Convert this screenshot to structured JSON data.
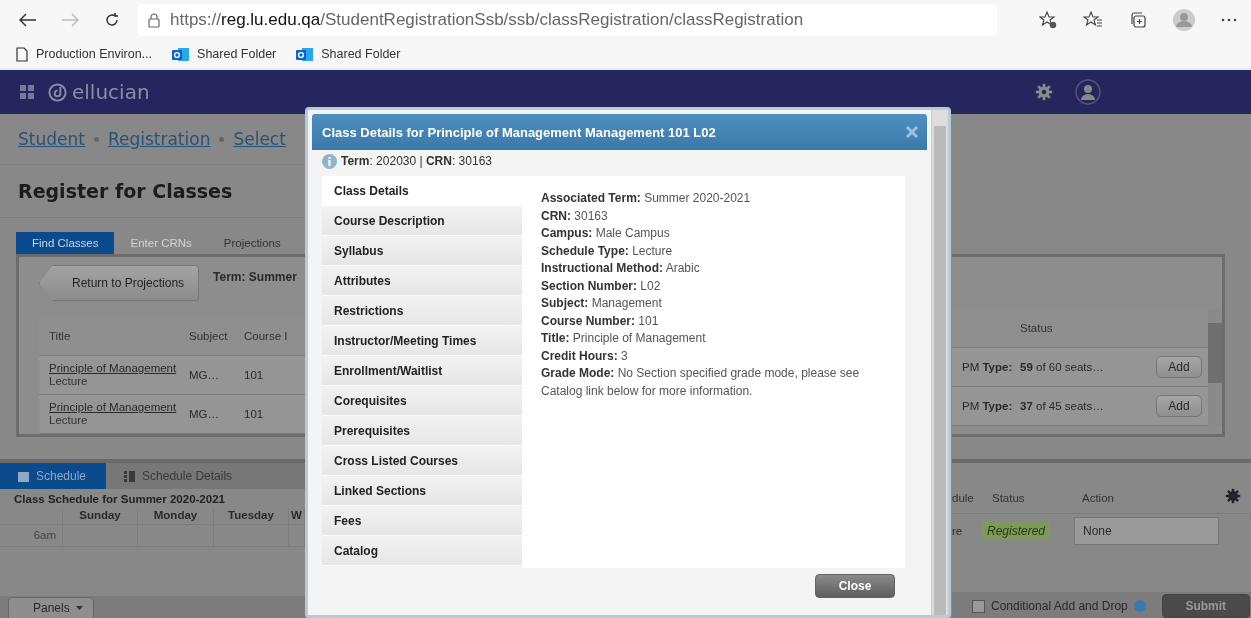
{
  "browser": {
    "nav_buttons": [
      {
        "kind": "back",
        "disabled": false
      },
      {
        "kind": "forward",
        "disabled": true
      },
      {
        "kind": "reload",
        "disabled": false
      }
    ],
    "url": {
      "scheme": "https://",
      "host": "reg.lu.edu.qa",
      "path": "/StudentRegistrationSsb/ssb/classRegistration/classRegistration"
    },
    "bookmarks": [
      {
        "kind": "page",
        "label": "Production Environ..."
      },
      {
        "kind": "outlook",
        "label": "Shared Folder"
      },
      {
        "kind": "outlook",
        "label": "Shared Folder"
      }
    ]
  },
  "app_header": {
    "brand": "ellucian"
  },
  "breadcrumb": [
    "Student",
    "Registration",
    "Select"
  ],
  "page_title": "Register for Classes",
  "tabs": [
    {
      "label": "Find Classes",
      "selected": true,
      "disabled": false
    },
    {
      "label": "Enter CRNs",
      "selected": false,
      "disabled": true
    },
    {
      "label": "Projections",
      "selected": false,
      "disabled": false
    }
  ],
  "return_button": "Return to Projections",
  "term_label": "Term: Summer",
  "results_table": {
    "columns": [
      "Title",
      "Subject",
      "Course I"
    ],
    "rows": [
      {
        "title": "Principle of Management",
        "schedule_type": "Lecture",
        "subject": "MG…",
        "course": "101",
        "meeting": "PM **Type:**",
        "seats": "**59** of 60 seats…",
        "action": "Add"
      },
      {
        "title": "Principle of Management",
        "schedule_type": "Lecture",
        "subject": "MG…",
        "course": "101",
        "meeting": "PM **Type:**",
        "seats": "**37** of 45 seats…",
        "action": "Add"
      }
    ],
    "right_columns": [
      "Status"
    ]
  },
  "schedule": {
    "tabs": [
      {
        "label": "Schedule",
        "selected": true
      },
      {
        "label": "Schedule Details",
        "selected": false
      }
    ],
    "title": "Class Schedule for Summer 2020-2021",
    "days": [
      "Sunday",
      "Monday",
      "Tuesday",
      "W"
    ],
    "times": [
      "6am"
    ]
  },
  "summary": {
    "columns": [
      "dule",
      "Status",
      "Action"
    ],
    "rows": [
      {
        "column_1": "re",
        "status": "Registered",
        "action": "None"
      }
    ]
  },
  "footer": {
    "panels_button": "Panels",
    "conditional": {
      "label": "Conditional Add and Drop",
      "checked": false
    },
    "submit": "Submit"
  },
  "modal": {
    "title": "Class Details for Principle of Management Management 101 L02",
    "info": "**Term**: 202030 | **CRN**: 30163",
    "nav": [
      {
        "label": "Class Details",
        "selected": true
      },
      {
        "label": "Course Description",
        "selected": false
      },
      {
        "label": "Syllabus",
        "selected": false
      },
      {
        "label": "Attributes",
        "selected": false
      },
      {
        "label": "Restrictions",
        "selected": false
      },
      {
        "label": "Instructor/Meeting Times",
        "selected": false
      },
      {
        "label": "Enrollment/Waitlist",
        "selected": false
      },
      {
        "label": "Corequisites",
        "selected": false
      },
      {
        "label": "Prerequisites",
        "selected": false
      },
      {
        "label": "Cross Listed Courses",
        "selected": false
      },
      {
        "label": "Linked Sections",
        "selected": false
      },
      {
        "label": "Fees",
        "selected": false
      },
      {
        "label": "Catalog",
        "selected": false
      }
    ],
    "details": [
      {
        "label": "Associated Term:",
        "value": "Summer 2020-2021"
      },
      {
        "label": "CRN:",
        "value": "30163"
      },
      {
        "label": "Campus:",
        "value": "Male Campus"
      },
      {
        "label": "Schedule Type:",
        "value": "Lecture"
      },
      {
        "label": "Instructional Method:",
        "value": "Arabic"
      },
      {
        "label": "Section Number:",
        "value": "L02"
      },
      {
        "label": "Subject:",
        "value": "Management"
      },
      {
        "label": "Course Number:",
        "value": "101"
      },
      {
        "label": "Title:",
        "value": "Principle of Management"
      },
      {
        "label": "Credit Hours:",
        "value": "3"
      },
      {
        "label": "Grade Mode:",
        "value": "No Section specified grade mode, please see Catalog link below for more information."
      }
    ],
    "close_button": "Close"
  }
}
